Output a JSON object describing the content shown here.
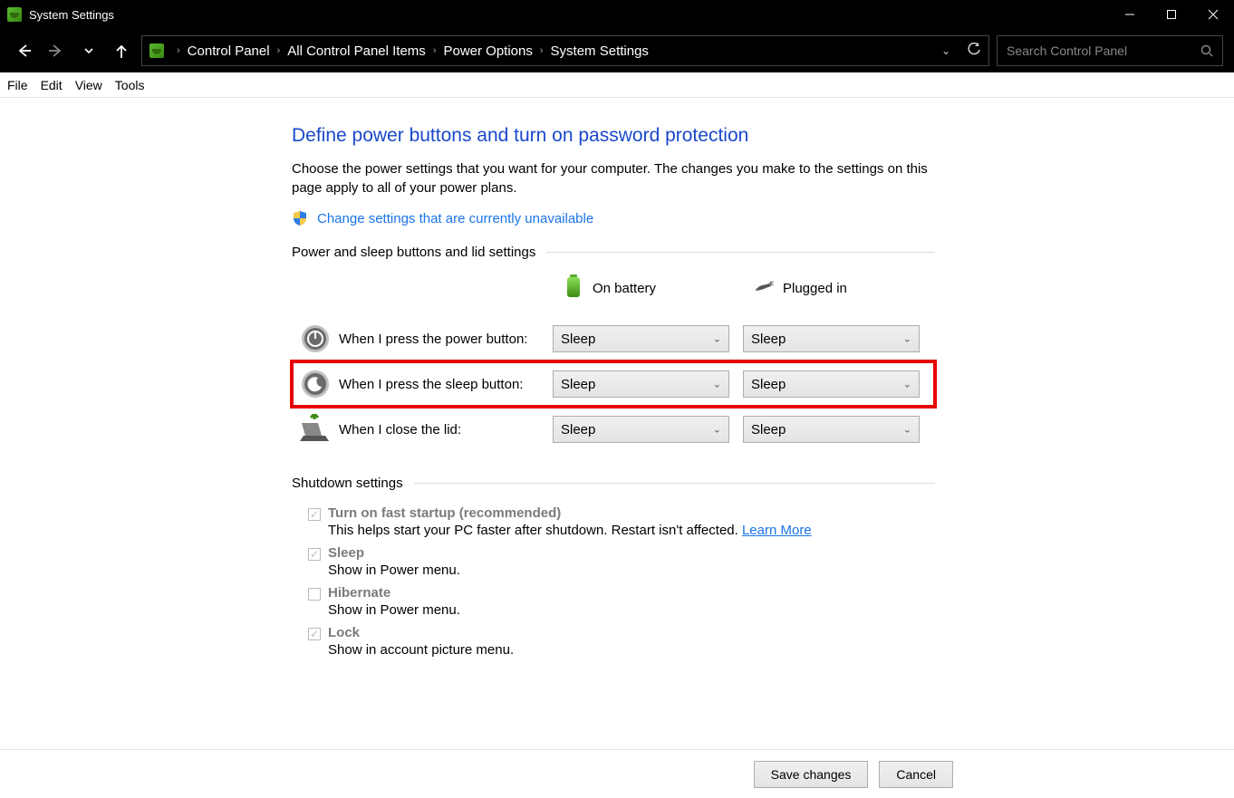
{
  "window": {
    "title": "System Settings"
  },
  "breadcrumbs": {
    "items": [
      "Control Panel",
      "All Control Panel Items",
      "Power Options",
      "System Settings"
    ]
  },
  "search": {
    "placeholder": "Search Control Panel"
  },
  "menubar": [
    "File",
    "Edit",
    "View",
    "Tools"
  ],
  "page": {
    "heading": "Define power buttons and turn on password protection",
    "description": "Choose the power settings that you want for your computer. The changes you make to the settings on this page apply to all of your power plans.",
    "admin_link": "Change settings that are currently unavailable",
    "section1": "Power and sleep buttons and lid settings",
    "col_battery": "On battery",
    "col_plugged": "Plugged in",
    "rows": [
      {
        "label": "When I press the power button:",
        "battery": "Sleep",
        "plugged": "Sleep"
      },
      {
        "label": "When I press the sleep button:",
        "battery": "Sleep",
        "plugged": "Sleep"
      },
      {
        "label": "When I close the lid:",
        "battery": "Sleep",
        "plugged": "Sleep"
      }
    ],
    "section2": "Shutdown settings",
    "shutdown": [
      {
        "checked": true,
        "title": "Turn on fast startup (recommended)",
        "desc": "This helps start your PC faster after shutdown. Restart isn't affected. ",
        "link": "Learn More"
      },
      {
        "checked": true,
        "title": "Sleep",
        "desc": "Show in Power menu."
      },
      {
        "checked": false,
        "title": "Hibernate",
        "desc": "Show in Power menu."
      },
      {
        "checked": true,
        "title": "Lock",
        "desc": "Show in account picture menu."
      }
    ]
  },
  "footer": {
    "save": "Save changes",
    "cancel": "Cancel"
  }
}
